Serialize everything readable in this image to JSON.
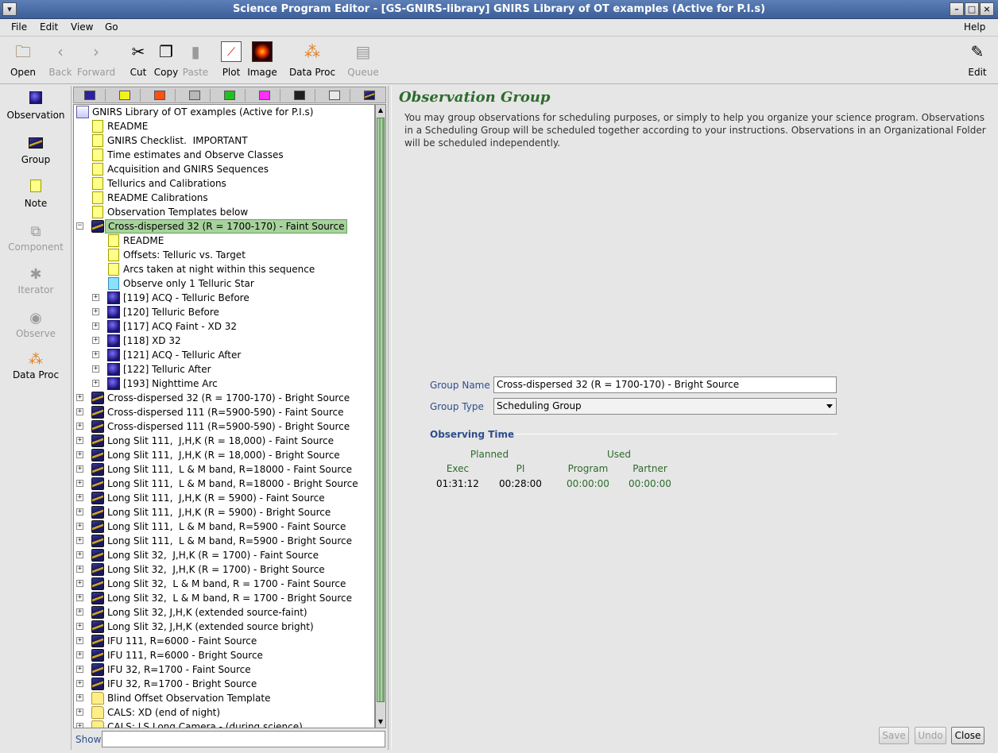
{
  "window": {
    "title": "Science Program Editor - [GS-GNIRS-library] GNIRS Library of OT examples (Active for P.I.s)"
  },
  "menu": [
    "File",
    "Edit",
    "View",
    "Go",
    "Help"
  ],
  "toolbar": {
    "open": "Open",
    "back": "Back",
    "forward": "Forward",
    "cut": "Cut",
    "copy": "Copy",
    "paste": "Paste",
    "plot": "Plot",
    "image": "Image",
    "dataproc": "Data Proc",
    "queue": "Queue",
    "edit": "Edit"
  },
  "leftbar": {
    "observation": "Observation",
    "group": "Group",
    "note": "Note",
    "component": "Component",
    "iterator": "Iterator",
    "observe": "Observe",
    "dataproc": "Data Proc"
  },
  "palette_colors": [
    "#2a20a0",
    "#f4f020",
    "#ff5010",
    "#b8b8b8",
    "#20c020",
    "#ff30ff",
    "#202020",
    "#e8e8e8"
  ],
  "tree": {
    "root": "GNIRS Library of OT examples (Active for P.I.s)",
    "items": [
      {
        "label": "README",
        "type": "note",
        "level": 1
      },
      {
        "label": "GNIRS Checklist.  IMPORTANT",
        "type": "note",
        "level": 1
      },
      {
        "label": "Time estimates and Observe Classes",
        "type": "note",
        "level": 1
      },
      {
        "label": "Acquisition and GNIRS Sequences",
        "type": "note",
        "level": 1
      },
      {
        "label": "Tellurics and Calibrations",
        "type": "note",
        "level": 1
      },
      {
        "label": "README Calibrations",
        "type": "note",
        "level": 1
      },
      {
        "label": "Observation Templates below",
        "type": "note",
        "level": 1
      },
      {
        "label": "Cross-dispersed 32 (R = 1700-170) - Faint Source",
        "type": "group",
        "level": 1,
        "expanded": true,
        "selected": true
      },
      {
        "label": "README",
        "type": "note",
        "level": 2
      },
      {
        "label": "Offsets: Telluric vs. Target",
        "type": "note",
        "level": 2
      },
      {
        "label": "Arcs taken at night within this sequence",
        "type": "note",
        "level": 2
      },
      {
        "label": "Observe only 1 Telluric Star",
        "type": "notec",
        "level": 2
      },
      {
        "label": "[119] ACQ - Telluric Before",
        "type": "obs",
        "level": 2
      },
      {
        "label": "[120] Telluric Before",
        "type": "obs",
        "level": 2
      },
      {
        "label": "[117] ACQ Faint - XD 32",
        "type": "obs",
        "level": 2
      },
      {
        "label": "[118] XD 32",
        "type": "obs",
        "level": 2
      },
      {
        "label": "[121] ACQ - Telluric After",
        "type": "obs",
        "level": 2
      },
      {
        "label": "[122] Telluric After",
        "type": "obs",
        "level": 2
      },
      {
        "label": "[193] Nighttime Arc",
        "type": "obs",
        "level": 2
      },
      {
        "label": "Cross-dispersed 32 (R = 1700-170) - Bright Source",
        "type": "group",
        "level": 1
      },
      {
        "label": "Cross-dispersed 111 (R=5900-590) - Faint Source",
        "type": "group",
        "level": 1
      },
      {
        "label": "Cross-dispersed 111 (R=5900-590) - Bright Source",
        "type": "group",
        "level": 1
      },
      {
        "label": "Long Slit 111,  J,H,K (R = 18,000) - Faint Source",
        "type": "group",
        "level": 1
      },
      {
        "label": "Long Slit 111,  J,H,K (R = 18,000) - Bright Source",
        "type": "group",
        "level": 1
      },
      {
        "label": "Long Slit 111,  L & M band, R=18000 - Faint Source",
        "type": "group",
        "level": 1
      },
      {
        "label": "Long Slit 111,  L & M band, R=18000 - Bright Source",
        "type": "group",
        "level": 1
      },
      {
        "label": "Long Slit 111,  J,H,K (R = 5900) - Faint Source",
        "type": "group",
        "level": 1
      },
      {
        "label": "Long Slit 111,  J,H,K (R = 5900) - Bright Source",
        "type": "group",
        "level": 1
      },
      {
        "label": "Long Slit 111,  L & M band, R=5900 - Faint Source",
        "type": "group",
        "level": 1
      },
      {
        "label": "Long Slit 111,  L & M band, R=5900 - Bright Source",
        "type": "group",
        "level": 1
      },
      {
        "label": "Long Slit 32,  J,H,K (R = 1700) - Faint Source",
        "type": "group",
        "level": 1
      },
      {
        "label": "Long Slit 32,  J,H,K (R = 1700) - Bright Source",
        "type": "group",
        "level": 1
      },
      {
        "label": "Long Slit 32,  L & M band, R = 1700 - Faint Source",
        "type": "group",
        "level": 1
      },
      {
        "label": "Long Slit 32,  L & M band, R = 1700 - Bright Source",
        "type": "group",
        "level": 1
      },
      {
        "label": "Long Slit 32, J,H,K (extended source-faint)",
        "type": "group",
        "level": 1
      },
      {
        "label": "Long Slit 32, J,H,K (extended source bright)",
        "type": "group",
        "level": 1
      },
      {
        "label": "IFU 111, R=6000 - Faint Source",
        "type": "group",
        "level": 1
      },
      {
        "label": "IFU 111, R=6000 - Bright Source",
        "type": "group",
        "level": 1
      },
      {
        "label": "IFU 32, R=1700 - Faint Source",
        "type": "group",
        "level": 1
      },
      {
        "label": "IFU 32, R=1700 - Bright Source",
        "type": "group",
        "level": 1
      },
      {
        "label": "Blind Offset Observation Template",
        "type": "folder",
        "level": 1
      },
      {
        "label": "CALS: XD (end of night)",
        "type": "folder",
        "level": 1
      },
      {
        "label": "CALS: LS Long Camera - (during science)",
        "type": "folder",
        "level": 1
      }
    ]
  },
  "show": {
    "label": "Show",
    "value": ""
  },
  "editor": {
    "title": "Observation Group",
    "description": "You may group observations for scheduling purposes, or simply to help you organize your science program. Observations in a Scheduling Group will be scheduled together according to your instructions. Observations in an Organizational Folder will be scheduled independently.",
    "group_name_label": "Group Name",
    "group_name_value": "Cross-dispersed 32 (R = 1700-170) - Bright Source",
    "group_type_label": "Group Type",
    "group_type_value": "Scheduling Group",
    "observing_time_label": "Observing Time",
    "planned_label": "Planned",
    "used_label": "Used",
    "exec_label": "Exec",
    "pi_label": "PI",
    "program_label": "Program",
    "partner_label": "Partner",
    "exec_value": "01:31:12",
    "pi_value": "00:28:00",
    "program_value": "00:00:00",
    "partner_value": "00:00:00"
  },
  "buttons": {
    "save": "Save",
    "undo": "Undo",
    "close": "Close"
  }
}
